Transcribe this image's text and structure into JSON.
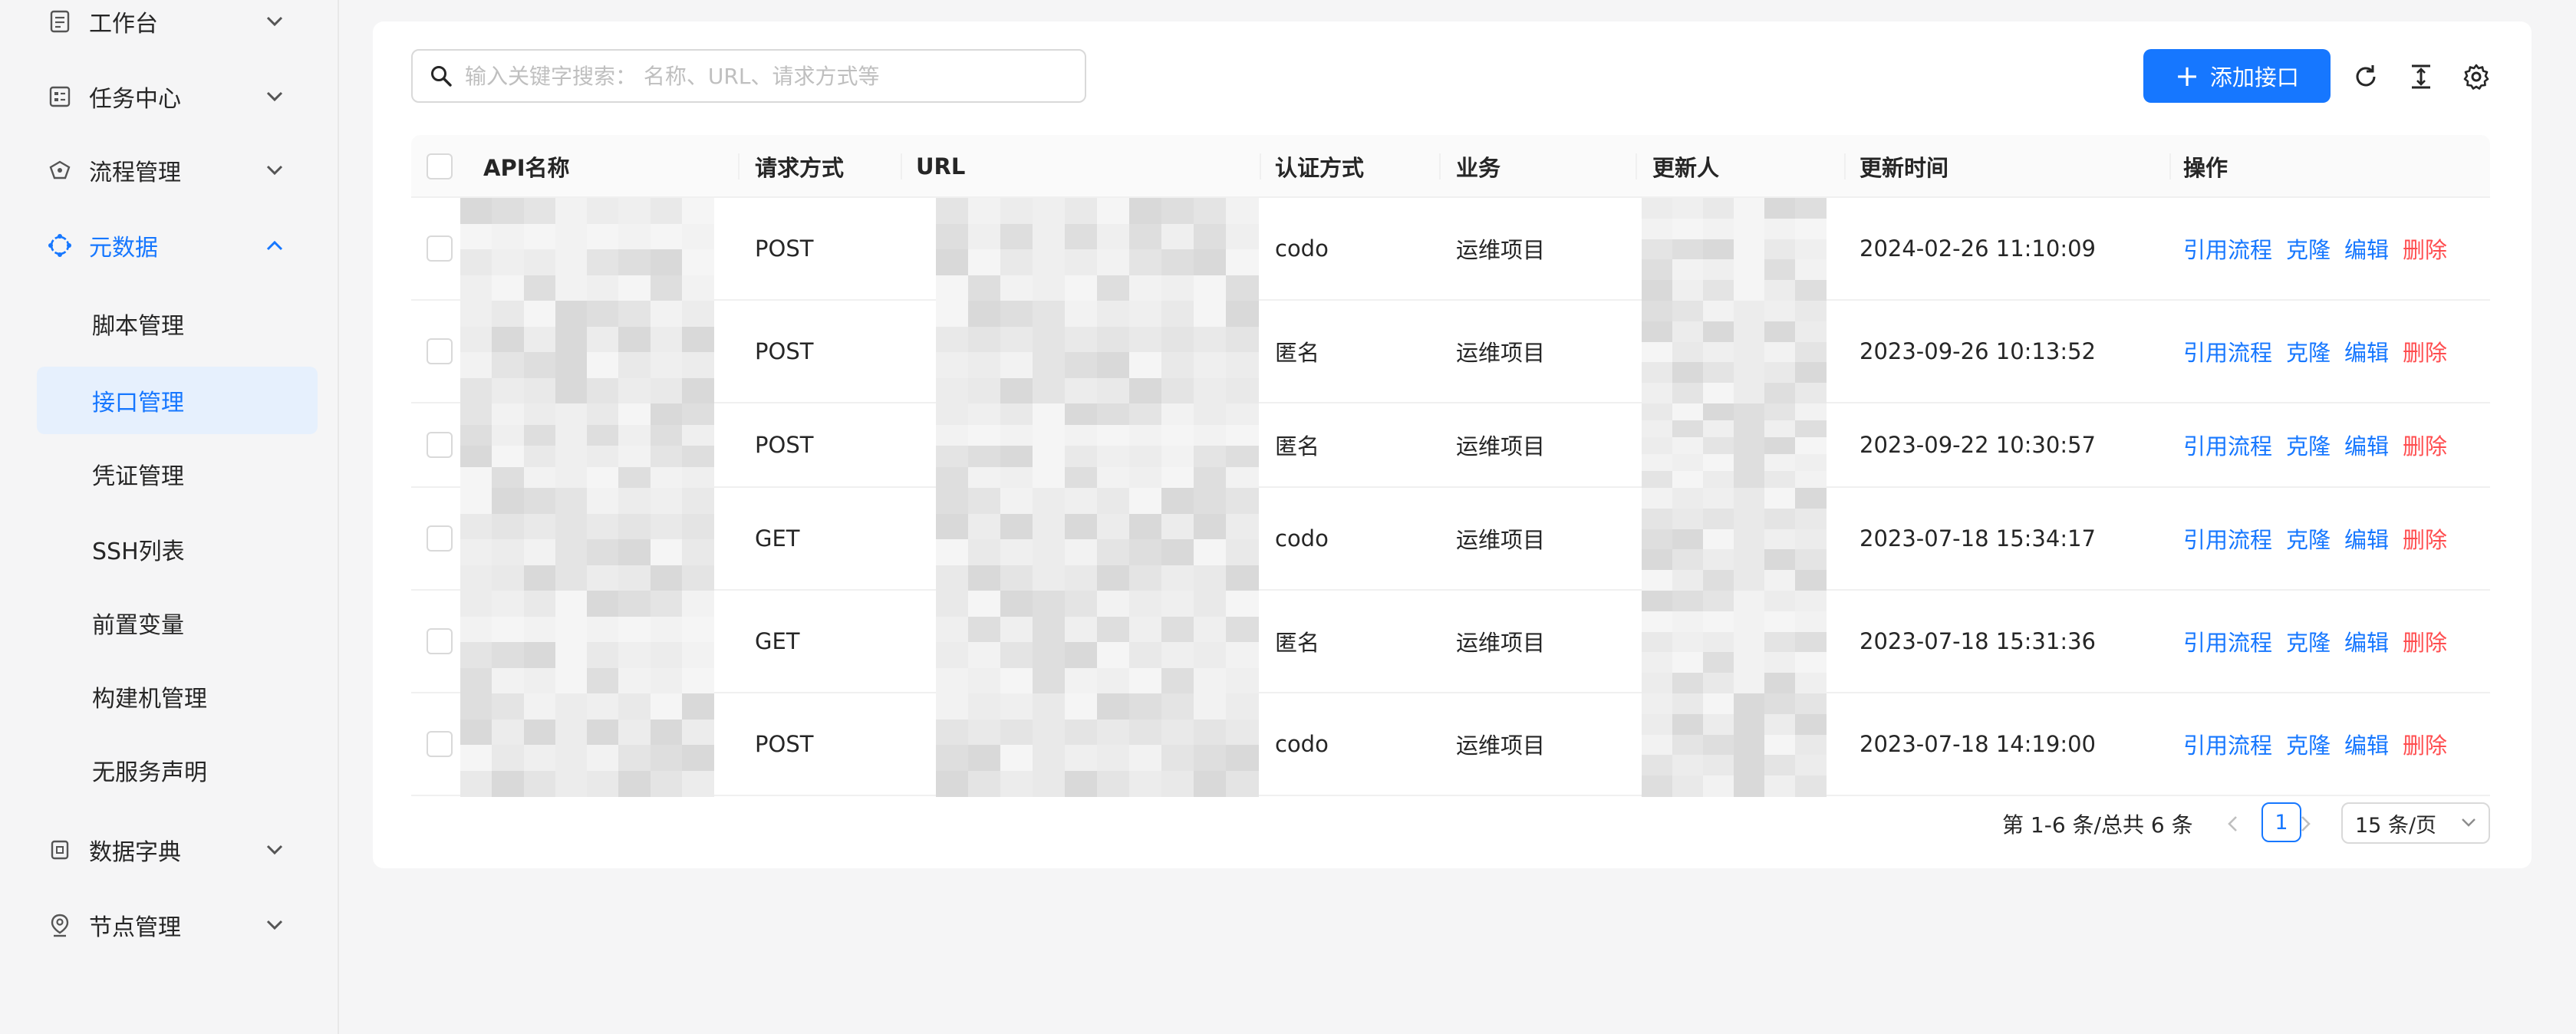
{
  "sidebar": {
    "groups": [
      {
        "label": "工作台",
        "icon": "document-icon"
      },
      {
        "label": "任务中心",
        "icon": "task-board-icon"
      },
      {
        "label": "流程管理",
        "icon": "flow-icon"
      },
      {
        "label": "元数据",
        "icon": "metadata-icon",
        "active": true
      },
      {
        "label": "数据字典",
        "icon": "dictionary-icon"
      },
      {
        "label": "节点管理",
        "icon": "location-pin-icon"
      }
    ],
    "sub_items": [
      {
        "label": "脚本管理"
      },
      {
        "label": "接口管理",
        "selected": true
      },
      {
        "label": "凭证管理"
      },
      {
        "label": "SSH列表"
      },
      {
        "label": "前置变量"
      },
      {
        "label": "构建机管理"
      },
      {
        "label": "无服务声明"
      }
    ]
  },
  "toolbar": {
    "search_placeholder": "输入关键字搜索： 名称、URL、请求方式等",
    "search_value": "",
    "add_label": "添加接口",
    "icons": [
      "refresh-icon",
      "column-height-icon",
      "settings-icon"
    ]
  },
  "table": {
    "columns": [
      "API名称",
      "请求方式",
      "URL",
      "认证方式",
      "业务",
      "更新人",
      "更新时间",
      "操作"
    ],
    "actions": {
      "cite": "引用流程",
      "clone": "克隆",
      "edit": "编辑",
      "delete": "删除"
    },
    "rows": [
      {
        "method": "POST",
        "auth": "codo",
        "business": "运维项目",
        "updated_at": "2024-02-26 11:10:09"
      },
      {
        "method": "POST",
        "auth": "匿名",
        "business": "运维项目",
        "updated_at": "2023-09-26 10:13:52"
      },
      {
        "method": "POST",
        "auth": "匿名",
        "business": "运维项目",
        "updated_at": "2023-09-22 10:30:57"
      },
      {
        "method": "GET",
        "auth": "codo",
        "business": "运维项目",
        "updated_at": "2023-07-18 15:34:17"
      },
      {
        "method": "GET",
        "auth": "匿名",
        "business": "运维项目",
        "updated_at": "2023-07-18 15:31:36"
      },
      {
        "method": "POST",
        "auth": "codo",
        "business": "运维项目",
        "updated_at": "2023-07-18 14:19:00"
      }
    ]
  },
  "pagination": {
    "total_text": "第 1-6 条/总共 6 条",
    "current_page": "1",
    "page_size": "15 条/页"
  },
  "colors": {
    "primary": "#1677ff",
    "danger": "#ff4d4f",
    "selected_bg": "#e6f0fd"
  }
}
